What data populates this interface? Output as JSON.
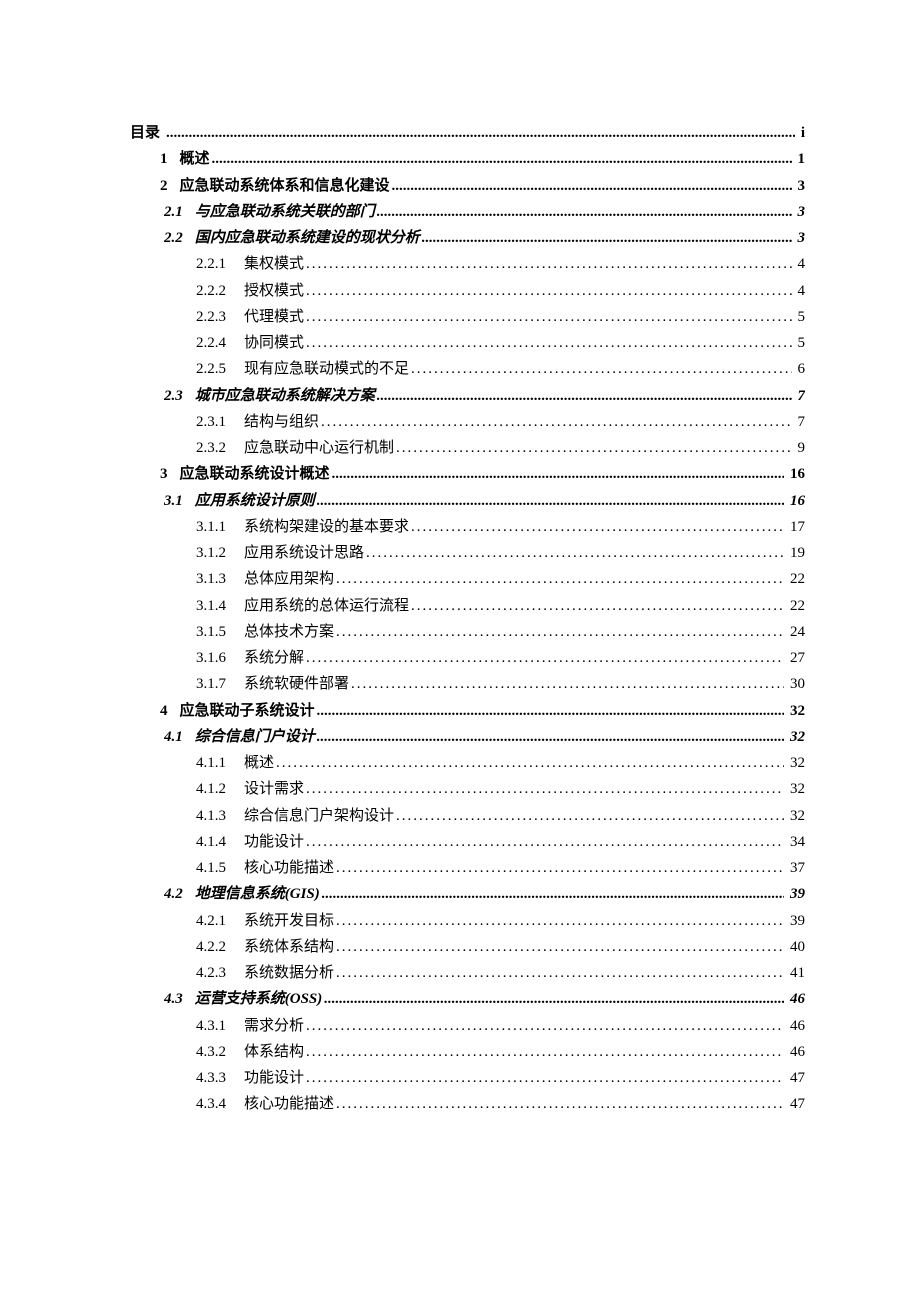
{
  "toc": [
    {
      "level": 0,
      "num": "",
      "title": "目录",
      "page": "i"
    },
    {
      "level": 1,
      "num": "1",
      "title": "概述",
      "page": "1"
    },
    {
      "level": 1,
      "num": "2",
      "title": "应急联动系统体系和信息化建设",
      "page": "3"
    },
    {
      "level": 2,
      "num": "2.1",
      "title": "与应急联动系统关联的部门",
      "page": "3"
    },
    {
      "level": 2,
      "num": "2.2",
      "title": "国内应急联动系统建设的现状分析",
      "page": "3"
    },
    {
      "level": 3,
      "num": "2.2.1",
      "title": "集权模式",
      "page": "4"
    },
    {
      "level": 3,
      "num": "2.2.2",
      "title": "授权模式",
      "page": "4"
    },
    {
      "level": 3,
      "num": "2.2.3",
      "title": "代理模式",
      "page": "5"
    },
    {
      "level": 3,
      "num": "2.2.4",
      "title": "协同模式",
      "page": "5"
    },
    {
      "level": 3,
      "num": "2.2.5",
      "title": "现有应急联动模式的不足",
      "page": "6"
    },
    {
      "level": 2,
      "num": "2.3",
      "title": "城市应急联动系统解决方案",
      "page": "7"
    },
    {
      "level": 3,
      "num": "2.3.1",
      "title": "结构与组织",
      "page": "7"
    },
    {
      "level": 3,
      "num": "2.3.2",
      "title": "应急联动中心运行机制",
      "page": "9"
    },
    {
      "level": 1,
      "num": "3",
      "title": "应急联动系统设计概述",
      "page": "16"
    },
    {
      "level": 2,
      "num": "3.1",
      "title": "应用系统设计原则",
      "page": "16"
    },
    {
      "level": 3,
      "num": "3.1.1",
      "title": "系统构架建设的基本要求",
      "page": "17"
    },
    {
      "level": 3,
      "num": "3.1.2",
      "title": "应用系统设计思路",
      "page": "19"
    },
    {
      "level": 3,
      "num": "3.1.3",
      "title": "总体应用架构",
      "page": "22"
    },
    {
      "level": 3,
      "num": "3.1.4",
      "title": "应用系统的总体运行流程",
      "page": "22"
    },
    {
      "level": 3,
      "num": "3.1.5",
      "title": "总体技术方案",
      "page": "24"
    },
    {
      "level": 3,
      "num": "3.1.6",
      "title": "系统分解",
      "page": "27"
    },
    {
      "level": 3,
      "num": "3.1.7",
      "title": "系统软硬件部署",
      "page": "30"
    },
    {
      "level": 1,
      "num": "4",
      "title": "应急联动子系统设计",
      "page": "32"
    },
    {
      "level": 2,
      "num": "4.1",
      "title": "综合信息门户设计",
      "page": "32"
    },
    {
      "level": 3,
      "num": "4.1.1",
      "title": "概述",
      "page": "32"
    },
    {
      "level": 3,
      "num": "4.1.2",
      "title": "设计需求",
      "page": "32"
    },
    {
      "level": 3,
      "num": "4.1.3",
      "title": "综合信息门户架构设计",
      "page": "32"
    },
    {
      "level": 3,
      "num": "4.1.4",
      "title": "功能设计",
      "page": "34"
    },
    {
      "level": 3,
      "num": "4.1.5",
      "title": "核心功能描述",
      "page": "37"
    },
    {
      "level": 2,
      "num": "4.2",
      "title": "地理信息系统(GIS)",
      "page": "39"
    },
    {
      "level": 3,
      "num": "4.2.1",
      "title": "系统开发目标",
      "page": "39"
    },
    {
      "level": 3,
      "num": "4.2.2",
      "title": "系统体系结构",
      "page": "40"
    },
    {
      "level": 3,
      "num": "4.2.3",
      "title": "系统数据分析",
      "page": "41"
    },
    {
      "level": 2,
      "num": "4.3",
      "title": "运营支持系统(OSS)",
      "page": "46"
    },
    {
      "level": 3,
      "num": "4.3.1",
      "title": "需求分析",
      "page": "46"
    },
    {
      "level": 3,
      "num": "4.3.2",
      "title": "体系结构",
      "page": "46"
    },
    {
      "level": 3,
      "num": "4.3.3",
      "title": "功能设计",
      "page": "47"
    },
    {
      "level": 3,
      "num": "4.3.4",
      "title": "核心功能描述",
      "page": "47"
    }
  ]
}
